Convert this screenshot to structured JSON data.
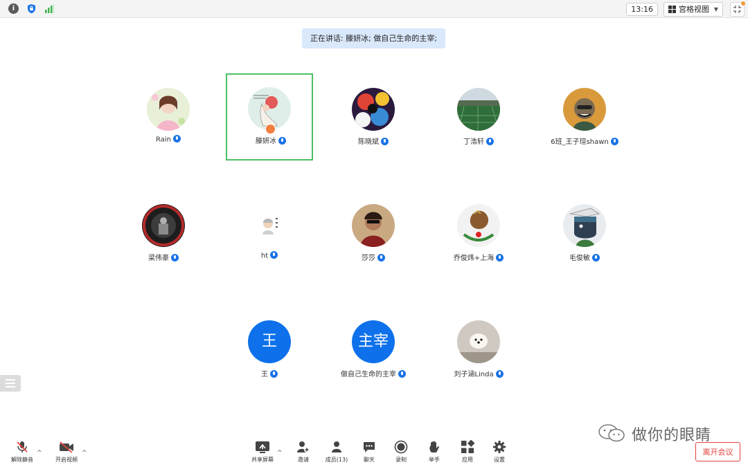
{
  "topbar": {
    "time": "13:16",
    "view_label": "宫格视图",
    "icons": [
      "info-icon",
      "shield-icon",
      "signal-icon",
      "grid-view-icon",
      "exit-fullscreen-icon"
    ]
  },
  "speaking_banner": "正在讲话: 滕妍冰; 做自己生命的主宰;",
  "participants": [
    {
      "name": "Rain"
    },
    {
      "name": "滕妍冰"
    },
    {
      "name": "陈晓斌"
    },
    {
      "name": "丁浩轩"
    },
    {
      "name": "6班_王子瑄shawn"
    },
    {
      "name": "梁伟豪"
    },
    {
      "name": "ht"
    },
    {
      "name": "莎莎"
    },
    {
      "name": "乔俊炜+上海"
    },
    {
      "name": "毛俊敏"
    },
    {
      "name": "王",
      "initials": "王"
    },
    {
      "name": "做自己生命的主宰",
      "initials": "主宰"
    },
    {
      "name": "刘子涵Linda"
    }
  ],
  "watermark": "做你的眼睛",
  "toolbar": {
    "unmute": "解除静音",
    "start_video": "开启视频",
    "share_screen": "共享屏幕",
    "invite": "邀请",
    "participants": "成员(13)",
    "chat": "聊天",
    "record": "录制",
    "raise_hand": "举手",
    "apps": "应用",
    "settings": "设置",
    "leave": "离开会议"
  },
  "colors": {
    "accent": "#0e71eb",
    "mic_blue": "#1a73e8",
    "active_border": "#4cc063",
    "leave_red": "#e6413a",
    "banner_bg": "#d9e8fb"
  }
}
